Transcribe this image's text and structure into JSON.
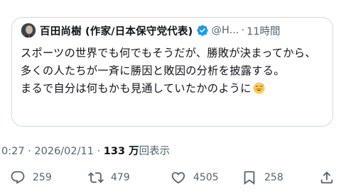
{
  "quoted_post": {
    "author_name": "百田尚樹 (作家/日本保守党代表)",
    "handle": "@H...",
    "separator": "·",
    "time_ago": "11時間",
    "text": "スポーツの世界でも何でもそうだが、勝敗が決まってから、多くの人たちが一斉に勝因と敗因の分析を披露する。\nまるで自分は何もかも見通していたかのように",
    "emoji_icon": "grinning-sweat-emoji"
  },
  "meta": {
    "prefix": "0:27 · 2026/02/11 · ",
    "views_count": "133 万",
    "views_label": "回表示"
  },
  "actions": {
    "reply_count": "259",
    "retweet_count": "479",
    "like_count": "4505",
    "bookmark_count": "258"
  },
  "colors": {
    "text_primary": "#0f1419",
    "text_secondary": "#536471",
    "border": "#cfd9de",
    "verified_blue": "#1d9bf0"
  }
}
